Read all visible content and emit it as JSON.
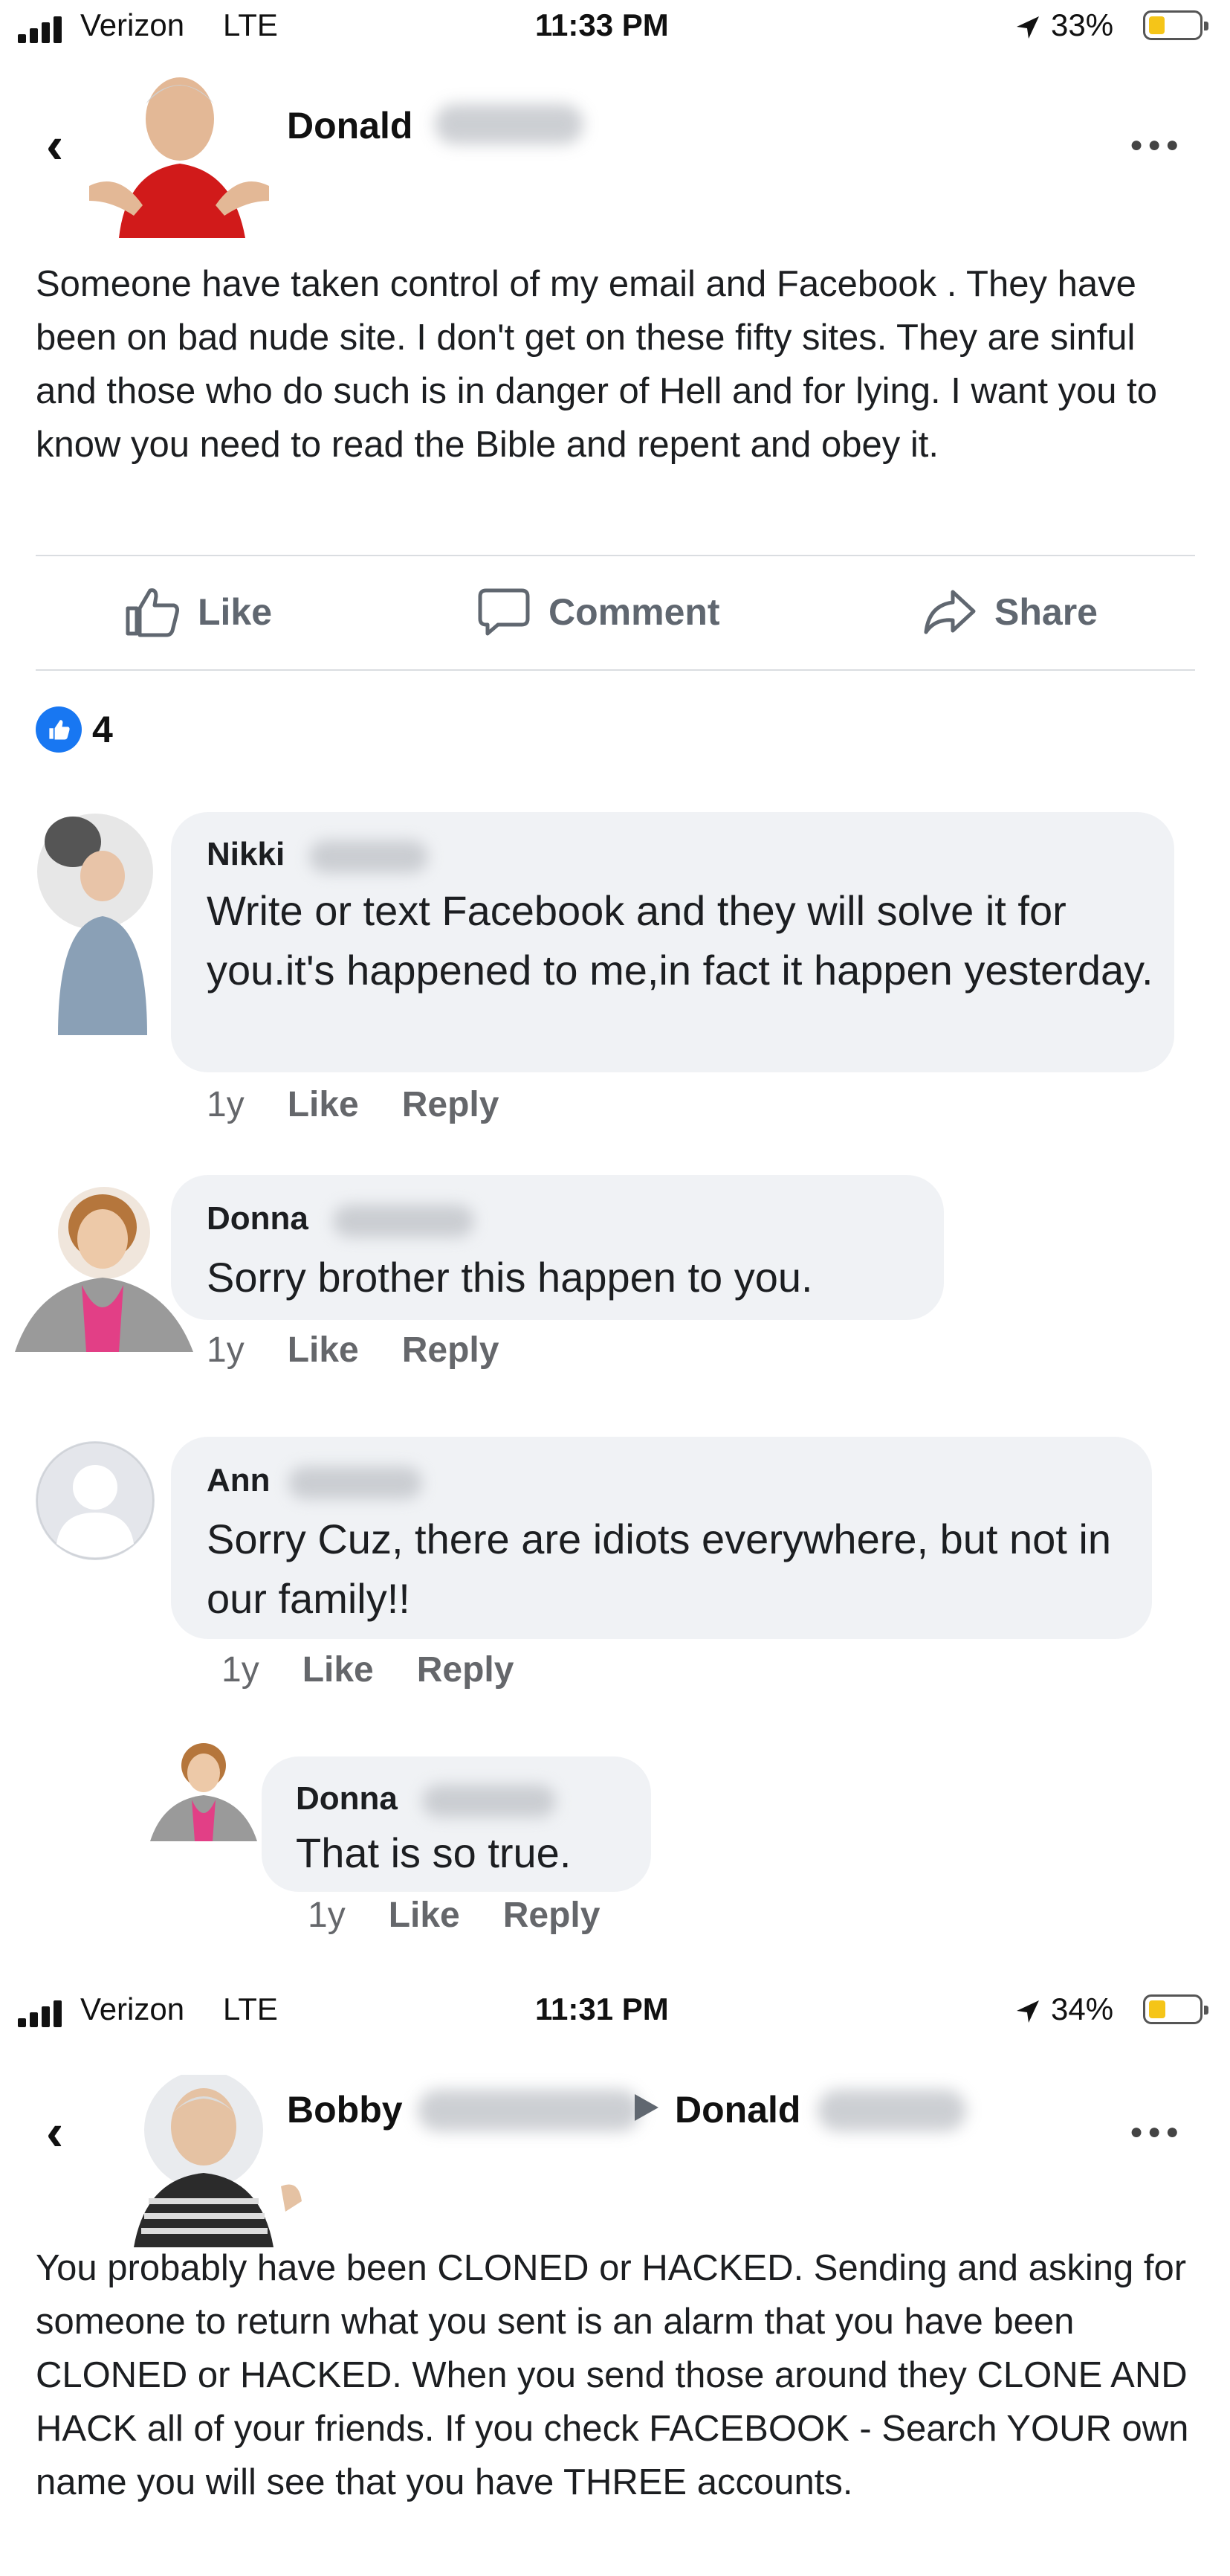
{
  "screens": [
    {
      "status": {
        "carrier": "Verizon",
        "network": "LTE",
        "time": "11:33 PM",
        "battery": "33%",
        "battery_level": 0.33
      },
      "header": {
        "author": "Donald",
        "more_icon": "ellipsis-icon",
        "back_icon": "chevron-left-icon"
      },
      "post_text": "Someone have taken control of my email and Facebook . They have been on bad nude site. I don't get on these fifty sites. They are sinful and those who do such is in danger of Hell and for lying.  I want you to know you need to read the Bible and repent and obey it.",
      "actions": {
        "like": "Like",
        "comment": "Comment",
        "share": "Share"
      },
      "reactions": {
        "count": "4",
        "icon": "thumbs-up-icon"
      },
      "comments": [
        {
          "name": "Nikki",
          "text": "Write or text Facebook and they will solve it for you.it's happened to me,in fact it happen yesterday.",
          "time": "1y",
          "like": "Like",
          "reply": "Reply"
        },
        {
          "name": "Donna",
          "text": "Sorry brother this happen to you.",
          "time": "1y",
          "like": "Like",
          "reply": "Reply"
        },
        {
          "name": "Ann",
          "text": "Sorry Cuz, there are idiots everywhere, but not in our family!!",
          "time": "1y",
          "like": "Like",
          "reply": "Reply"
        },
        {
          "name": "Donna",
          "text": "That is so true.",
          "time": "1y",
          "like": "Like",
          "reply": "Reply"
        }
      ]
    },
    {
      "status": {
        "carrier": "Verizon",
        "network": "LTE",
        "time": "11:31 PM",
        "battery": "34%",
        "battery_level": 0.34
      },
      "header": {
        "author": "Bobby",
        "recipient": "Donald",
        "more_icon": "ellipsis-icon",
        "back_icon": "chevron-left-icon"
      },
      "post_text": "You probably have been CLONED or HACKED. Sending and asking for someone to return what you sent is an alarm that you have been CLONED or HACKED. When you send those around they CLONE AND HACK all of your friends. If you check FACEBOOK - Search YOUR own name you will see that you have THREE accounts."
    }
  ]
}
